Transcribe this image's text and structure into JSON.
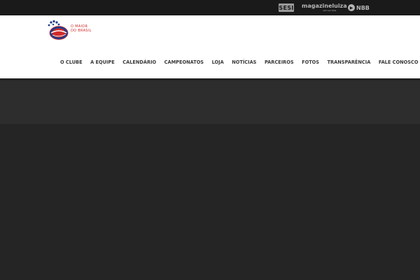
{
  "sponsors": {
    "sesi": "SESI",
    "magazine": "magazineluiza",
    "magazine_sub": "vem ser feliz",
    "nbb": "NBB"
  },
  "logo": {
    "line1": "O MAIOR",
    "line2": "DO BRASIL",
    "colors": {
      "red": "#d12b2b",
      "blue": "#1d3f8a"
    }
  },
  "nav": {
    "items": [
      "O CLUBE",
      "A EQUIPE",
      "CALENDÁRIO",
      "CAMPEONATOS",
      "LOJA",
      "NOTÍCIAS",
      "PARCEIROS",
      "FOTOS",
      "TRANSPARÊNCIA",
      "FALE CONOSCO"
    ]
  }
}
